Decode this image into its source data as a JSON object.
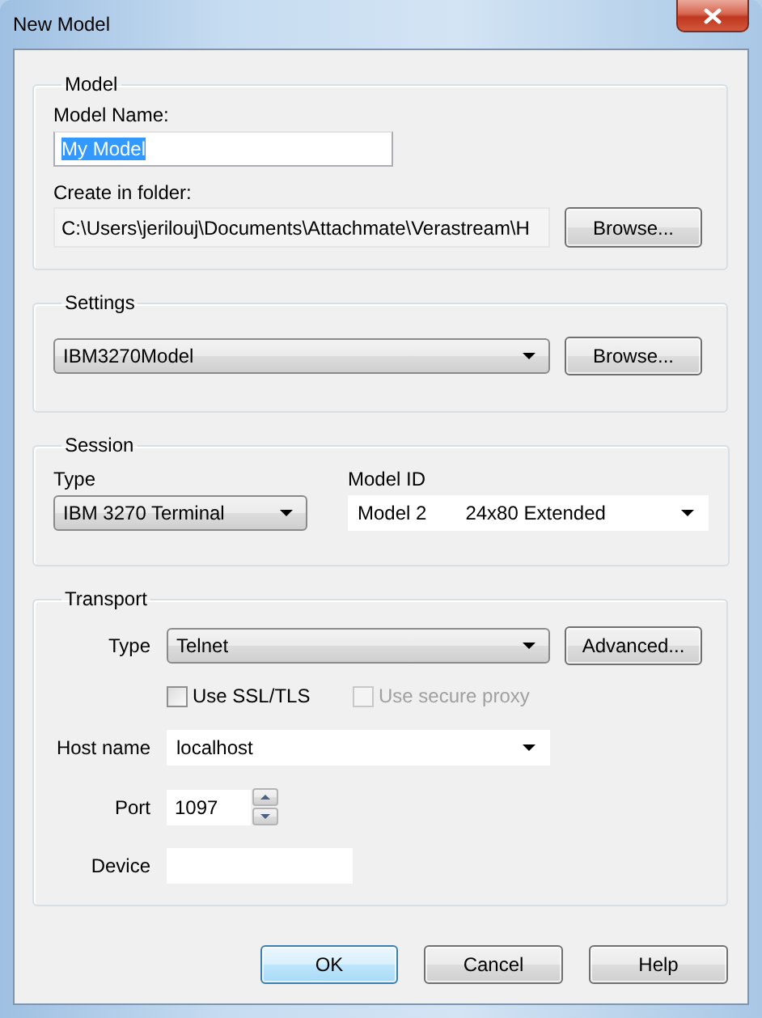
{
  "window": {
    "title": "New Model"
  },
  "model": {
    "title": "Model",
    "name_label": "Model Name:",
    "name_value": "My Model",
    "name_value_selected": true,
    "folder_label": "Create in folder:",
    "folder_value": "C:\\Users\\jerilouj\\Documents\\Attachmate\\Verastream\\H",
    "browse_button": "Browse..."
  },
  "settings": {
    "title": "Settings",
    "value": "IBM3270Model",
    "browse_button": "Browse..."
  },
  "session": {
    "title": "Session",
    "type_label": "Type",
    "type_value": "IBM 3270 Terminal",
    "model_id_label": "Model ID",
    "model_id_value": "Model 2",
    "model_id_description": "24x80 Extended"
  },
  "transport": {
    "title": "Transport",
    "type_label": "Type",
    "type_value": "Telnet",
    "advanced_button": "Advanced...",
    "options": [
      {
        "label": "Use SSL/TLS",
        "checked": false,
        "disabled": false
      },
      {
        "label": "Use secure proxy",
        "checked": false,
        "disabled": true
      }
    ],
    "host_label": "Host name",
    "host_value": "localhost",
    "port_label": "Port",
    "port_value": "1097",
    "device_label": "Device"
  },
  "buttons": [
    {
      "label": "OK",
      "default": true
    },
    {
      "label": "Cancel",
      "default": false
    },
    {
      "label": "Help",
      "default": false
    }
  ]
}
